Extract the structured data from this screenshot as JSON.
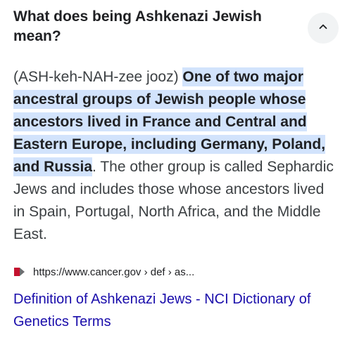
{
  "question": {
    "text": "What does being Ashkenazi Jewish mean?"
  },
  "answer": {
    "pronunciation": "(ASH-keh-NAH-zee jooz)",
    "highlight": "One of two major ancestral groups of Jewish people whose ancestors lived in France and Central and Eastern Europe, including Germany, Poland, and Russia",
    "rest": ". The other group is called Sephardic Jews and includes those whose ancestors lived in Spain, Portugal, North Africa, and the Middle East."
  },
  "source": {
    "url": "https://www.cancer.gov › def › as...",
    "icon": "cancer-gov-favicon-icon"
  },
  "result": {
    "title": "Definition of Ashkenazi Jews - NCI Dictionary of Genetics Terms"
  },
  "colors": {
    "highlight_bg": "#d2e3fc",
    "link": "#1a0dab",
    "favicon_red": "#c4122f"
  },
  "icons": {
    "collapse": "chevron-up-icon"
  }
}
